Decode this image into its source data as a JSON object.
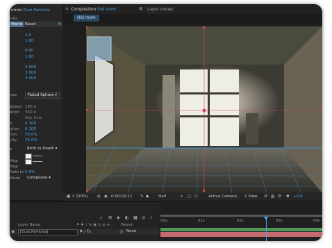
{
  "effect_controls": {
    "tab_label_prefix": "ntrols",
    "tab_label_layer": "Dust Particles",
    "subtitle": "cles",
    "header": {
      "world": "World",
      "reset": "Reset",
      "ab": "Al"
    },
    "rows": [
      {
        "label": "",
        "value": "2.0"
      },
      {
        "label": "",
        "value": "1.00"
      },
      {
        "label": "",
        "value": "0.00"
      },
      {
        "label": "",
        "value": "1.00"
      },
      {
        "label": "",
        "value": "3.000"
      },
      {
        "label": "",
        "value": "3.000"
      },
      {
        "label": "",
        "value": "3.000"
      }
    ],
    "shape_label": "ype",
    "shape_value": "Faded Sphere",
    "rows2": [
      {
        "label": "Speed",
        "value": "180.0"
      },
      {
        "label": "ation",
        "value": "360.0"
      },
      {
        "label": "",
        "value": "Any Axis"
      },
      {
        "label": "n",
        "value": "0.100"
      },
      {
        "label": "ution",
        "value": "0.100"
      },
      {
        "label": "tion",
        "value": "50.0%"
      },
      {
        "label": "city",
        "value": "75.0%"
      }
    ],
    "lifecycle_label": "e",
    "lifecycle_value": "Birth to Death",
    "bottom_rows": [
      {
        "label": "Map",
        "value": ""
      },
      {
        "label": "Map",
        "value": ""
      },
      {
        "label": "Fade Ia",
        "value": "0.0%"
      }
    ],
    "mode_label": "Mode",
    "mode_value": "Composite"
  },
  "composition": {
    "panel_title_prefix": "Composition",
    "panel_title_name": "Old room",
    "layer_panel": "Layer (none)",
    "active_tab": "Old room"
  },
  "viewer_toolbar": {
    "zoom": "(50%)",
    "timecode": "0:00:02:11",
    "resolution": "Half",
    "camera": "Active Camera",
    "views": "1 View",
    "exposure": "+0.0"
  },
  "timeline": {
    "col_layer_name": "Layer Name",
    "col_parent": "Parent",
    "layer_name": "[Dust Particles]",
    "parent_value": "None",
    "ruler": [
      "00s",
      "01s",
      "02s",
      "03s",
      "04s"
    ]
  },
  "colors": {
    "accent": "#4fa3e3",
    "bar_video": "#4f9a58",
    "bar_layer": "#c56a6f",
    "playhead": "#3ea6ff",
    "guide": "#e0405a"
  }
}
